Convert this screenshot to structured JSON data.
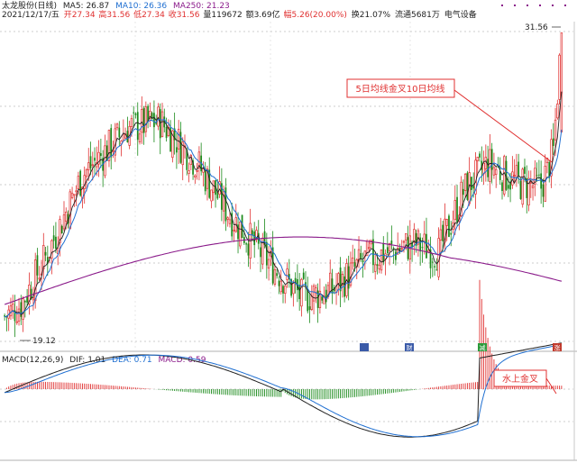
{
  "header": {
    "title": "太龙股份(日线)",
    "ma5": "MA5: 26.87",
    "ma10": "MA10: 26.36",
    "ma250": "MA250: 21.23",
    "date": "2021/12/17/五",
    "open": "开27.34",
    "high": "高31.56",
    "low": "低27.34",
    "close": "收31.56",
    "volume": "量119672",
    "amount": "额3.69亿",
    "change": "幅5.26(20.00%)",
    "turnover": "换21.07%",
    "float": "流通5681万",
    "sector": "电气设备"
  },
  "price_labels": {
    "high": "31.56",
    "low": "19.12"
  },
  "annotations": {
    "ma_cross": "5日均线金叉10日均线",
    "macd_cross": "水上金叉"
  },
  "markers": [
    "",
    "财",
    "减",
    "涨"
  ],
  "macd_header": {
    "name": "MACD(12,26,9)",
    "dif": "DIF: 1.01",
    "dea": "DEA: 0.71",
    "macd": "MACD: 0.59"
  },
  "colors": {
    "up": "#e03030",
    "down": "#1a8a1a",
    "ma5": "#222222",
    "ma10": "#1f6fd1",
    "ma250": "#8a1a8a",
    "annotation": "#e03030"
  },
  "chart_data": {
    "type": "candlestick",
    "price_high": 31.56,
    "price_low": 19.12,
    "x_axis": "trading days (unlabeled)",
    "y_axis": "price (unlabeled)",
    "indicators": [
      "MA5",
      "MA10",
      "MA250",
      "MACD(12,26,9)"
    ],
    "latest": {
      "open": 27.34,
      "high": 31.56,
      "low": 27.34,
      "close": 31.56,
      "change_pct": 20.0
    },
    "macd_latest": {
      "dif": 1.01,
      "dea": 0.71,
      "macd": 0.59
    }
  }
}
